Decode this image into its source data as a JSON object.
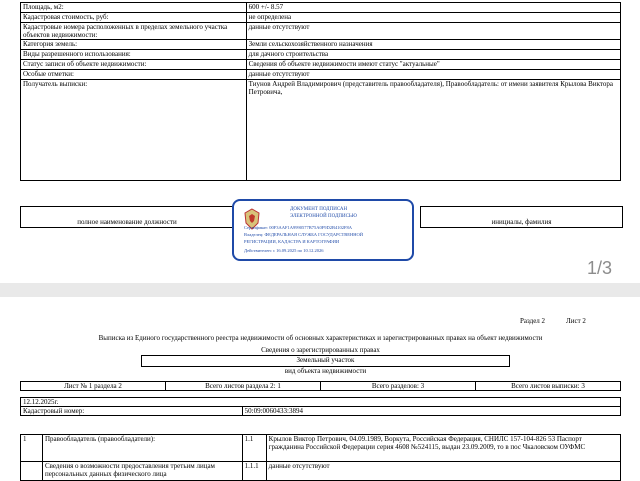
{
  "page1": {
    "rows": [
      {
        "label": "Площадь, м2:",
        "value": "600 +/- 8.57"
      },
      {
        "label": "Кадастровая стоимость, руб:",
        "value": "не определена"
      },
      {
        "label": "Кадастровые номера расположенных в пределах земельного участка объектов недвижимости:",
        "value": "данные отсутствуют"
      },
      {
        "label": "Категория земель:",
        "value": "Земли сельскохозяйственного назначения"
      },
      {
        "label": "Виды разрешенного использования:",
        "value": "для дачного строительства"
      },
      {
        "label": "Статус записи об объекте недвижимости:",
        "value": "Сведения об объекте недвижимости имеют статус \"актуальные\""
      },
      {
        "label": "Особые отметки:",
        "value": "данные отсутствуют"
      },
      {
        "label": "Получатель выписки:",
        "value": "Тиунов Андрей Владимирович (представитель правообладателя), Правообладатель: от имени заявителя Крылова Виктора Петровича,"
      }
    ],
    "signature": {
      "position_label": "полное наименование должности",
      "name_label": "инициалы, фамилия"
    },
    "stamp": {
      "title": "ДОКУМЕНТ ПОДПИСАН",
      "subtitle": "ЭЛЕКТРОННОЙ ПОДПИСЬЮ",
      "cert": "Сертификат: 00F3AAF1A9990577B75A0F9D2B4102F8A",
      "owner1": "Владелец: ФЕДЕРАЛЬНАЯ СЛУЖБА ГОСУДАРСТВЕННОЙ",
      "owner2": "РЕГИСТРАЦИИ, КАДАСТРА И КАРТОГРАФИИ",
      "valid": "Действителен: с 16.09.2025 по 10.12.2026"
    },
    "page_indicator": "1/3"
  },
  "page2": {
    "section": "Раздел 2",
    "sheet": "Лист 2",
    "title": "Выписка из Единого государственного реестра недвижимости об основных характеристиках и зарегистрированных правах на объект недвижимости",
    "subtitle": "Сведения о зарегистрированных правах",
    "object_type": "Земельный участок",
    "object_type_caption": "вид объекта недвижимости",
    "counts": {
      "sheet_no": "Лист № 1 раздела 2",
      "total_sheets_section": "Всего листов раздела 2: 1",
      "total_sections": "Всего разделов: 3",
      "total_sheets": "Всего листов выписки: 3"
    },
    "date": "12.12.2025г.",
    "cadastral_label": "Кадастровый номер:",
    "cadastral_value": "50:09:0060433:3894",
    "rights": [
      {
        "num": "1",
        "label": "Правообладатель (правообладатели):",
        "sub": "1.1",
        "value": "Крылов Виктор Петрович, 04.09.1989, Воркута, Российская Федерация, СНИЛС 157-104-826 53 Паспорт гражданина Российской Федерации серия 4608 №524115, выдан 23.09.2009, то в пос Чкаловском ОУФМС"
      },
      {
        "num": "",
        "label": "Сведения о возможности предоставления третьим лицам персональных данных физического лица",
        "sub": "1.1.1",
        "value": "данные отсутствуют"
      }
    ]
  }
}
